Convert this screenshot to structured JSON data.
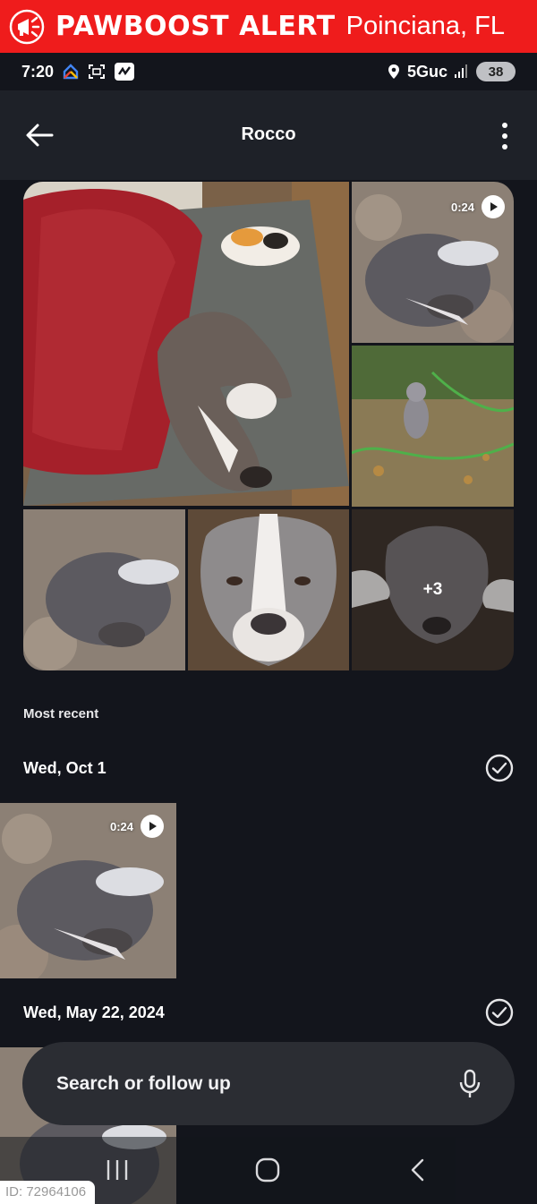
{
  "alert": {
    "title": "PAWBOOST ALERT",
    "location": "Poinciana, FL",
    "icon": "megaphone-icon",
    "color": "#ef1c1c"
  },
  "status_bar": {
    "time": "7:20",
    "network": "5Guc",
    "battery": "38"
  },
  "app_bar": {
    "title": "Rocco"
  },
  "collage": {
    "video_duration": "0:24",
    "more_count": "+3"
  },
  "section": {
    "label": "Most recent"
  },
  "groups": [
    {
      "date": "Wed, Oct 1",
      "video_duration": "0:24"
    },
    {
      "date": "Wed, May 22, 2024"
    }
  ],
  "search": {
    "placeholder": "Search or follow up"
  },
  "footer": {
    "id_label": "ID: 72964106"
  }
}
